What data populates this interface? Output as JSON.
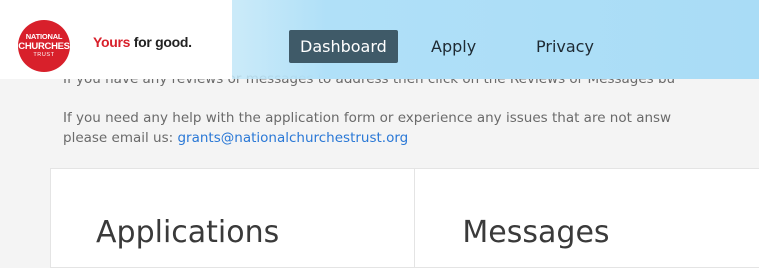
{
  "brand": {
    "logo_line1": "NATIONAL",
    "logo_line2": "CHURCHES",
    "logo_line3": "TRUST",
    "tagline_part1": "Yours ",
    "tagline_part2": "for good.",
    "brand_color": "#d8202b"
  },
  "nav": {
    "items": [
      {
        "label": "Dashboard",
        "active": true
      },
      {
        "label": "Apply",
        "active": false
      },
      {
        "label": "Privacy",
        "active": false
      }
    ],
    "active_bg": "#3f5a68",
    "band_color": "#a9dcf6"
  },
  "content": {
    "cutoff_line": "If you have any reviews or messages to address then click on the Reviews or Messages bu",
    "help_line1": "If you need any help with the application form or experience any issues that are not answ",
    "help_line2_prefix": "please email us: ",
    "help_email": "grants@nationalchurchestrust.org"
  },
  "cards": [
    {
      "title": "Applications"
    },
    {
      "title": "Messages"
    }
  ]
}
